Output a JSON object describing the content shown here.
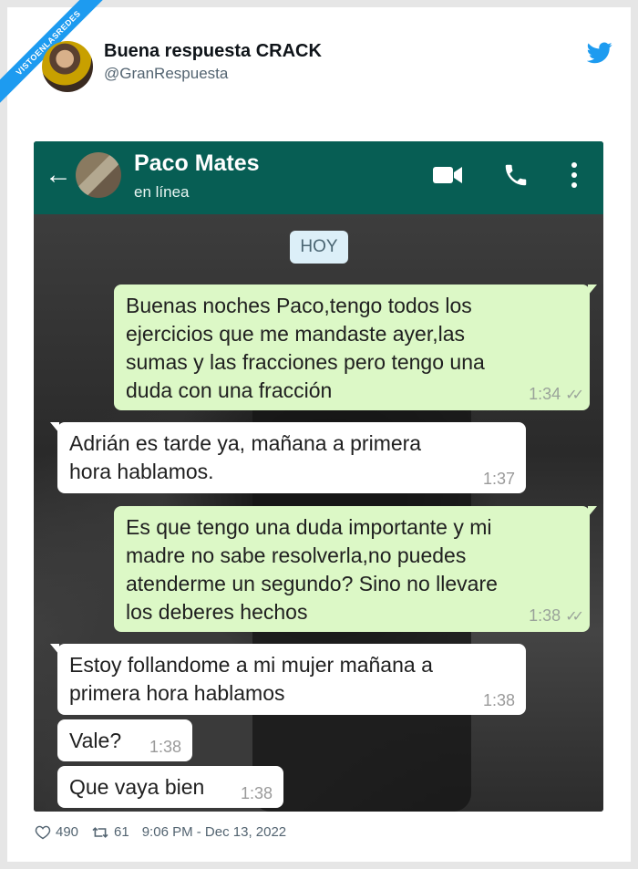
{
  "watermark": "VISTOENLASREDES",
  "tweet": {
    "author_name": "Buena respuesta CRACK",
    "author_handle": "@GranRespuesta",
    "likes": "490",
    "retweets": "61",
    "timestamp": "9:06 PM - Dec 13, 2022"
  },
  "chat": {
    "contact_name": "Paco Mates",
    "contact_status": "en línea",
    "date_label": "HOY",
    "messages": [
      {
        "direction": "out",
        "text": "Buenas noches Paco,tengo todos los\nejercicios que me mandaste ayer,las\nsumas y las fracciones pero tengo una\nduda con una fracción",
        "time": "1:34"
      },
      {
        "direction": "in",
        "text": "Adrián es tarde ya, mañana a primera\nhora hablamos.",
        "time": "1:37"
      },
      {
        "direction": "out",
        "text": "Es que tengo una duda importante y mi\nmadre no sabe resolverla,no puedes\natenderme un segundo? Sino no llevare\nlos deberes hechos",
        "time": "1:38"
      },
      {
        "direction": "in",
        "text": "Estoy follandome a mi mujer mañana a\nprimera hora hablamos",
        "time": "1:38"
      },
      {
        "direction": "in",
        "text": "Vale?",
        "time": "1:38"
      },
      {
        "direction": "in",
        "text": "Que vaya bien",
        "time": "1:38"
      }
    ]
  },
  "colors": {
    "whatsapp_header": "#075e54",
    "outgoing_bubble": "#dcf8c6",
    "incoming_bubble": "#ffffff",
    "twitter_blue": "#1d9bf0"
  },
  "icons": [
    "back-arrow-icon",
    "video-call-icon",
    "phone-icon",
    "more-vert-icon",
    "twitter-bird-icon",
    "heart-icon",
    "retweet-icon",
    "double-check-icon"
  ]
}
